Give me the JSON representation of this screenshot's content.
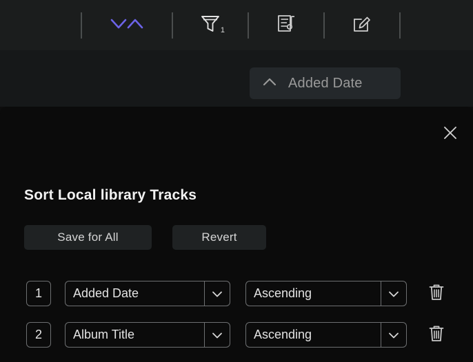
{
  "toolbar": {
    "items": [
      {
        "name": "sort-toggle-button",
        "icon": "sort-chevrons-icon",
        "label": "",
        "accent": "#6c63e8"
      },
      {
        "name": "filter-button",
        "icon": "filter-funnel-icon",
        "label": "",
        "badge": "1"
      },
      {
        "name": "queue-button",
        "icon": "playlist-note-icon",
        "label": ""
      },
      {
        "name": "edit-button",
        "icon": "edit-pencil-square-icon",
        "label": ""
      }
    ]
  },
  "subbar": {
    "added_date_pill": {
      "label": "Added Date",
      "icon": "chevron-up-icon"
    }
  },
  "dialog": {
    "title": "Sort Local library Tracks",
    "close_icon": "close-x-icon",
    "save_label": "Save for All",
    "revert_label": "Revert",
    "rows": [
      {
        "rank": "1",
        "field": "Added Date",
        "direction": "Ascending",
        "field_arrow_icon": "chevron-down-icon",
        "direction_arrow_icon": "chevron-down-icon",
        "delete_icon": "trash-icon"
      },
      {
        "rank": "2",
        "field": "Album Title",
        "direction": "Ascending",
        "field_arrow_icon": "chevron-down-icon",
        "direction_arrow_icon": "chevron-down-icon",
        "delete_icon": "trash-icon"
      }
    ]
  },
  "colors": {
    "toolbar_bg": "#1b1d1d",
    "subbar_bg": "#161819",
    "dialog_bg": "#0b0b0b",
    "accent": "#6c63e8",
    "text_primary": "#f2f2f2",
    "text_secondary": "#9a9a9a",
    "border": "#6e7072"
  }
}
